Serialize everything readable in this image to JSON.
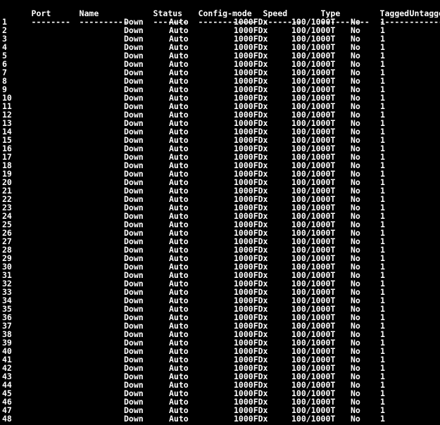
{
  "terminal": {
    "background_color": "#000000",
    "foreground_color": "#ffffff",
    "columns": {
      "port": "Port",
      "name": "Name",
      "status": "Status",
      "config_mode": "Config-mode",
      "speed": "Speed",
      "type": "Type",
      "tagged": "Tagged",
      "untagged": "Untagged"
    },
    "separators": {
      "port": "--------",
      "name": "----------",
      "status": "-------",
      "config_mode": "------------",
      "speed": "--------",
      "type": "----------",
      "tagged": "------",
      "untagged": "--------"
    },
    "rows": [
      {
        "port": "1",
        "name": "",
        "status": "Down",
        "config_mode": "Auto",
        "speed": "1000FDx",
        "type": "100/1000T",
        "tagged": "No",
        "untagged": "1"
      },
      {
        "port": "2",
        "name": "",
        "status": "Down",
        "config_mode": "Auto",
        "speed": "1000FDx",
        "type": "100/1000T",
        "tagged": "No",
        "untagged": "1"
      },
      {
        "port": "3",
        "name": "",
        "status": "Down",
        "config_mode": "Auto",
        "speed": "1000FDx",
        "type": "100/1000T",
        "tagged": "No",
        "untagged": "1"
      },
      {
        "port": "4",
        "name": "",
        "status": "Down",
        "config_mode": "Auto",
        "speed": "1000FDx",
        "type": "100/1000T",
        "tagged": "No",
        "untagged": "1"
      },
      {
        "port": "5",
        "name": "",
        "status": "Down",
        "config_mode": "Auto",
        "speed": "1000FDx",
        "type": "100/1000T",
        "tagged": "No",
        "untagged": "1"
      },
      {
        "port": "6",
        "name": "",
        "status": "Down",
        "config_mode": "Auto",
        "speed": "1000FDx",
        "type": "100/1000T",
        "tagged": "No",
        "untagged": "1"
      },
      {
        "port": "7",
        "name": "",
        "status": "Down",
        "config_mode": "Auto",
        "speed": "1000FDx",
        "type": "100/1000T",
        "tagged": "No",
        "untagged": "1"
      },
      {
        "port": "8",
        "name": "",
        "status": "Down",
        "config_mode": "Auto",
        "speed": "1000FDx",
        "type": "100/1000T",
        "tagged": "No",
        "untagged": "1"
      },
      {
        "port": "9",
        "name": "",
        "status": "Down",
        "config_mode": "Auto",
        "speed": "1000FDx",
        "type": "100/1000T",
        "tagged": "No",
        "untagged": "1"
      },
      {
        "port": "10",
        "name": "",
        "status": "Down",
        "config_mode": "Auto",
        "speed": "1000FDx",
        "type": "100/1000T",
        "tagged": "No",
        "untagged": "1"
      },
      {
        "port": "11",
        "name": "",
        "status": "Down",
        "config_mode": "Auto",
        "speed": "1000FDx",
        "type": "100/1000T",
        "tagged": "No",
        "untagged": "1"
      },
      {
        "port": "12",
        "name": "",
        "status": "Down",
        "config_mode": "Auto",
        "speed": "1000FDx",
        "type": "100/1000T",
        "tagged": "No",
        "untagged": "1"
      },
      {
        "port": "13",
        "name": "",
        "status": "Down",
        "config_mode": "Auto",
        "speed": "1000FDx",
        "type": "100/1000T",
        "tagged": "No",
        "untagged": "1"
      },
      {
        "port": "14",
        "name": "",
        "status": "Down",
        "config_mode": "Auto",
        "speed": "1000FDx",
        "type": "100/1000T",
        "tagged": "No",
        "untagged": "1"
      },
      {
        "port": "15",
        "name": "",
        "status": "Down",
        "config_mode": "Auto",
        "speed": "1000FDx",
        "type": "100/1000T",
        "tagged": "No",
        "untagged": "1"
      },
      {
        "port": "16",
        "name": "",
        "status": "Down",
        "config_mode": "Auto",
        "speed": "1000FDx",
        "type": "100/1000T",
        "tagged": "No",
        "untagged": "1"
      },
      {
        "port": "17",
        "name": "",
        "status": "Down",
        "config_mode": "Auto",
        "speed": "1000FDx",
        "type": "100/1000T",
        "tagged": "No",
        "untagged": "1"
      },
      {
        "port": "18",
        "name": "",
        "status": "Down",
        "config_mode": "Auto",
        "speed": "1000FDx",
        "type": "100/1000T",
        "tagged": "No",
        "untagged": "1"
      },
      {
        "port": "19",
        "name": "",
        "status": "Down",
        "config_mode": "Auto",
        "speed": "1000FDx",
        "type": "100/1000T",
        "tagged": "No",
        "untagged": "1"
      },
      {
        "port": "20",
        "name": "",
        "status": "Down",
        "config_mode": "Auto",
        "speed": "1000FDx",
        "type": "100/1000T",
        "tagged": "No",
        "untagged": "1"
      },
      {
        "port": "21",
        "name": "",
        "status": "Down",
        "config_mode": "Auto",
        "speed": "1000FDx",
        "type": "100/1000T",
        "tagged": "No",
        "untagged": "1"
      },
      {
        "port": "22",
        "name": "",
        "status": "Down",
        "config_mode": "Auto",
        "speed": "1000FDx",
        "type": "100/1000T",
        "tagged": "No",
        "untagged": "1"
      },
      {
        "port": "23",
        "name": "",
        "status": "Down",
        "config_mode": "Auto",
        "speed": "1000FDx",
        "type": "100/1000T",
        "tagged": "No",
        "untagged": "1"
      },
      {
        "port": "24",
        "name": "",
        "status": "Down",
        "config_mode": "Auto",
        "speed": "1000FDx",
        "type": "100/1000T",
        "tagged": "No",
        "untagged": "1"
      },
      {
        "port": "25",
        "name": "",
        "status": "Down",
        "config_mode": "Auto",
        "speed": "1000FDx",
        "type": "100/1000T",
        "tagged": "No",
        "untagged": "1"
      },
      {
        "port": "26",
        "name": "",
        "status": "Down",
        "config_mode": "Auto",
        "speed": "1000FDx",
        "type": "100/1000T",
        "tagged": "No",
        "untagged": "1"
      },
      {
        "port": "27",
        "name": "",
        "status": "Down",
        "config_mode": "Auto",
        "speed": "1000FDx",
        "type": "100/1000T",
        "tagged": "No",
        "untagged": "1"
      },
      {
        "port": "28",
        "name": "",
        "status": "Down",
        "config_mode": "Auto",
        "speed": "1000FDx",
        "type": "100/1000T",
        "tagged": "No",
        "untagged": "1"
      },
      {
        "port": "29",
        "name": "",
        "status": "Down",
        "config_mode": "Auto",
        "speed": "1000FDx",
        "type": "100/1000T",
        "tagged": "No",
        "untagged": "1"
      },
      {
        "port": "30",
        "name": "",
        "status": "Down",
        "config_mode": "Auto",
        "speed": "1000FDx",
        "type": "100/1000T",
        "tagged": "No",
        "untagged": "1"
      },
      {
        "port": "31",
        "name": "",
        "status": "Down",
        "config_mode": "Auto",
        "speed": "1000FDx",
        "type": "100/1000T",
        "tagged": "No",
        "untagged": "1"
      },
      {
        "port": "32",
        "name": "",
        "status": "Down",
        "config_mode": "Auto",
        "speed": "1000FDx",
        "type": "100/1000T",
        "tagged": "No",
        "untagged": "1"
      },
      {
        "port": "33",
        "name": "",
        "status": "Down",
        "config_mode": "Auto",
        "speed": "1000FDx",
        "type": "100/1000T",
        "tagged": "No",
        "untagged": "1"
      },
      {
        "port": "34",
        "name": "",
        "status": "Down",
        "config_mode": "Auto",
        "speed": "1000FDx",
        "type": "100/1000T",
        "tagged": "No",
        "untagged": "1"
      },
      {
        "port": "35",
        "name": "",
        "status": "Down",
        "config_mode": "Auto",
        "speed": "1000FDx",
        "type": "100/1000T",
        "tagged": "No",
        "untagged": "1"
      },
      {
        "port": "36",
        "name": "",
        "status": "Down",
        "config_mode": "Auto",
        "speed": "1000FDx",
        "type": "100/1000T",
        "tagged": "No",
        "untagged": "1"
      },
      {
        "port": "37",
        "name": "",
        "status": "Down",
        "config_mode": "Auto",
        "speed": "1000FDx",
        "type": "100/1000T",
        "tagged": "No",
        "untagged": "1"
      },
      {
        "port": "38",
        "name": "",
        "status": "Down",
        "config_mode": "Auto",
        "speed": "1000FDx",
        "type": "100/1000T",
        "tagged": "No",
        "untagged": "1"
      },
      {
        "port": "39",
        "name": "",
        "status": "Down",
        "config_mode": "Auto",
        "speed": "1000FDx",
        "type": "100/1000T",
        "tagged": "No",
        "untagged": "1"
      },
      {
        "port": "40",
        "name": "",
        "status": "Down",
        "config_mode": "Auto",
        "speed": "1000FDx",
        "type": "100/1000T",
        "tagged": "No",
        "untagged": "1"
      },
      {
        "port": "41",
        "name": "",
        "status": "Down",
        "config_mode": "Auto",
        "speed": "1000FDx",
        "type": "100/1000T",
        "tagged": "No",
        "untagged": "1"
      },
      {
        "port": "42",
        "name": "",
        "status": "Down",
        "config_mode": "Auto",
        "speed": "1000FDx",
        "type": "100/1000T",
        "tagged": "No",
        "untagged": "1"
      },
      {
        "port": "43",
        "name": "",
        "status": "Down",
        "config_mode": "Auto",
        "speed": "1000FDx",
        "type": "100/1000T",
        "tagged": "No",
        "untagged": "1"
      },
      {
        "port": "44",
        "name": "",
        "status": "Down",
        "config_mode": "Auto",
        "speed": "1000FDx",
        "type": "100/1000T",
        "tagged": "No",
        "untagged": "1"
      },
      {
        "port": "45",
        "name": "",
        "status": "Down",
        "config_mode": "Auto",
        "speed": "1000FDx",
        "type": "100/1000T",
        "tagged": "No",
        "untagged": "1"
      },
      {
        "port": "46",
        "name": "",
        "status": "Down",
        "config_mode": "Auto",
        "speed": "1000FDx",
        "type": "100/1000T",
        "tagged": "No",
        "untagged": "1"
      },
      {
        "port": "47",
        "name": "",
        "status": "Down",
        "config_mode": "Auto",
        "speed": "1000FDx",
        "type": "100/1000T",
        "tagged": "No",
        "untagged": "1"
      },
      {
        "port": "48",
        "name": "",
        "status": "Down",
        "config_mode": "Auto",
        "speed": "1000FDx",
        "type": "100/1000T",
        "tagged": "No",
        "untagged": "1"
      }
    ]
  }
}
